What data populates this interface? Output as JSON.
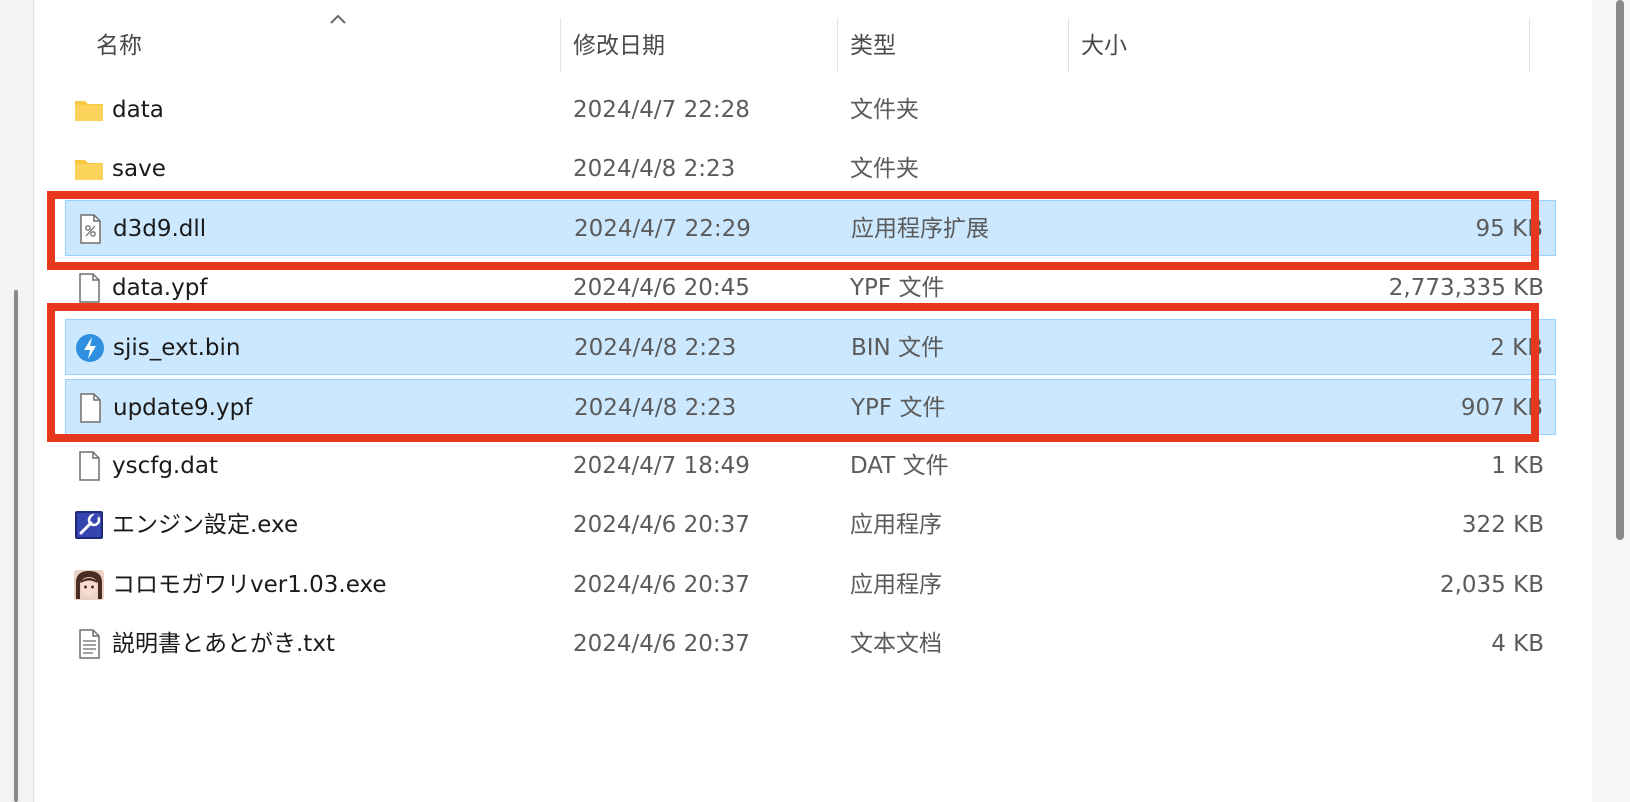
{
  "columns": {
    "name": "名称",
    "date": "修改日期",
    "type": "类型",
    "size": "大小"
  },
  "sort": {
    "column": "name",
    "direction": "ascending",
    "icon": "chevron-up-icon"
  },
  "files": [
    {
      "name": "data",
      "date": "2024/4/7 22:28",
      "type": "文件夹",
      "size": "",
      "icon": "folder-icon",
      "selected": false
    },
    {
      "name": "save",
      "date": "2024/4/8 2:23",
      "type": "文件夹",
      "size": "",
      "icon": "folder-icon",
      "selected": false
    },
    {
      "name": "d3d9.dll",
      "date": "2024/4/7 22:29",
      "type": "应用程序扩展",
      "size": "95 KB",
      "icon": "dll-file-icon",
      "selected": true
    },
    {
      "name": "data.ypf",
      "date": "2024/4/6 20:45",
      "type": "YPF 文件",
      "size": "2,773,335 KB",
      "icon": "blank-file-icon",
      "selected": false
    },
    {
      "name": "sjis_ext.bin",
      "date": "2024/4/8 2:23",
      "type": "BIN 文件",
      "size": "2 KB",
      "icon": "bin-lightning-icon",
      "selected": true
    },
    {
      "name": "update9.ypf",
      "date": "2024/4/8 2:23",
      "type": "YPF 文件",
      "size": "907 KB",
      "icon": "blank-file-icon",
      "selected": true
    },
    {
      "name": "yscfg.dat",
      "date": "2024/4/7 18:49",
      "type": "DAT 文件",
      "size": "1 KB",
      "icon": "blank-file-icon",
      "selected": false
    },
    {
      "name": "エンジン設定.exe",
      "date": "2024/4/6 20:37",
      "type": "应用程序",
      "size": "322 KB",
      "icon": "wrench-app-icon",
      "selected": false
    },
    {
      "name": "コロモガワリver1.03.exe",
      "date": "2024/4/6 20:37",
      "type": "应用程序",
      "size": "2,035 KB",
      "icon": "character-app-icon",
      "selected": false
    },
    {
      "name": "説明書とあとがき.txt",
      "date": "2024/4/6 20:37",
      "type": "文本文档",
      "size": "4 KB",
      "icon": "text-file-icon",
      "selected": false
    }
  ],
  "colors": {
    "selection": "#cce8ff",
    "selection_border": "#99d1ff",
    "highlight_frame": "#e8371f",
    "folder": "#f8c93e"
  }
}
